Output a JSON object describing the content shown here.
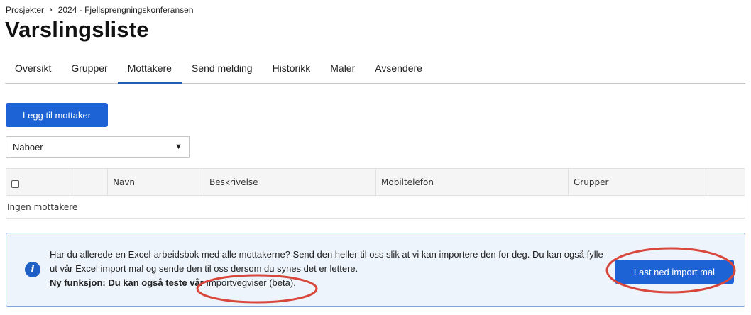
{
  "breadcrumb": {
    "root": "Prosjekter",
    "separator": "›",
    "current": "2024 - Fjellsprengningskonferansen"
  },
  "page_title": "Varslingsliste",
  "tabs": [
    {
      "label": "Oversikt",
      "active": false
    },
    {
      "label": "Grupper",
      "active": false
    },
    {
      "label": "Mottakere",
      "active": true
    },
    {
      "label": "Send melding",
      "active": false
    },
    {
      "label": "Historikk",
      "active": false
    },
    {
      "label": "Maler",
      "active": false
    },
    {
      "label": "Avsendere",
      "active": false
    }
  ],
  "add_button_label": "Legg til mottaker",
  "group_select": {
    "selected": "Naboer",
    "arrow_icon": "triangle-down-icon"
  },
  "table": {
    "columns": [
      "",
      "",
      "Navn",
      "Beskrivelse",
      "Mobiltelefon",
      "Grupper",
      ""
    ],
    "empty_text": "Ingen mottakere"
  },
  "info_box": {
    "icon": "info-icon",
    "text_line1": "Har du allerede en Excel-arbeidsbok med alle mottakerne? Send den heller til oss slik at vi kan importere den for deg. Du kan også fylle ut vår Excel import mal og sende den til oss dersom du synes det er lettere.",
    "text_line2_prefix": "Ny funksjon: Du kan også teste vår ",
    "link_label": "Importvegviser (beta)",
    "text_line2_suffix": ".",
    "download_button_label": "Last ned import mal"
  },
  "colors": {
    "primary": "#1e63d6",
    "tab_underline": "#1d5fb8",
    "info_bg": "#eef4fb",
    "info_border": "#7ea6d8",
    "annotation": "#d9463b"
  }
}
